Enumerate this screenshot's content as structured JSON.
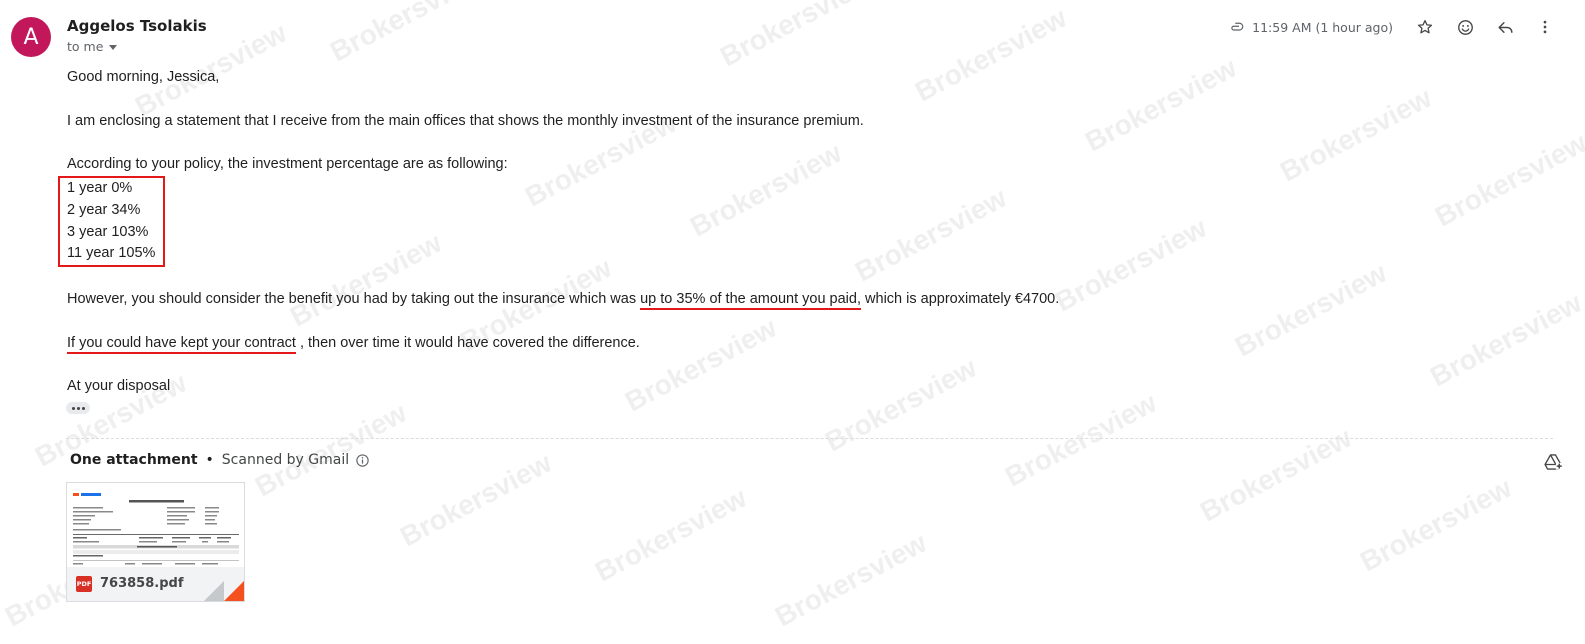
{
  "sender": {
    "initial": "A",
    "name": "Aggelos Tsolakis",
    "recipient": "to me"
  },
  "header": {
    "time": "11:59 AM (1 hour ago)",
    "icons": [
      "paperclip-icon",
      "star-icon",
      "emoji-icon",
      "reply-icon",
      "more-vert-icon"
    ]
  },
  "body": {
    "greeting": "Good morning, Jessica,",
    "para1": "I am enclosing a statement that I receive from the main offices that shows the monthly investment of the insurance premium.",
    "para2": "According to your policy,  the investment percentage are as following:",
    "list": [
      "1 year 0%",
      "2 year 34%",
      "3 year 103%",
      "11 year 105%"
    ],
    "para3_pre": "However, you should consider the benefit you had by taking out the insurance which was",
    "para3_hl": "up to 35% of the amount you paid,",
    "para3_post": "which is approximately €4700.",
    "para4_hl": "If you could have kept your contract",
    "para4_post": ", then over time it would have covered the difference.",
    "closing": "At your disposal"
  },
  "attachments": {
    "count_label": "One attachment",
    "scanned_label": "Scanned by Gmail",
    "file": {
      "name": "763858.pdf",
      "type": "PDF"
    }
  },
  "watermark": "Brokersview",
  "colors": {
    "avatar": "#c2185b",
    "highlight": "#e31818",
    "pdf": "#d93025",
    "fold": "#f4511e"
  }
}
